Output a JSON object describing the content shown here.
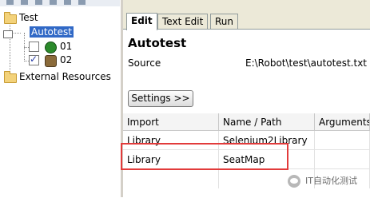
{
  "tree": {
    "root": "Test",
    "suite": "Autotest",
    "children": [
      {
        "label": "01",
        "checked": false
      },
      {
        "label": "02",
        "checked": true
      }
    ],
    "external": "External Resources"
  },
  "tabs": [
    {
      "label": "Edit",
      "active": true
    },
    {
      "label": "Text Edit",
      "active": false
    },
    {
      "label": "Run",
      "active": false
    }
  ],
  "editor": {
    "title": "Autotest",
    "source_label": "Source",
    "source_value": "E:\\Robot\\test\\autotest.txt",
    "settings_button": "Settings >>"
  },
  "table": {
    "columns": [
      "Import",
      "Name / Path",
      "Arguments"
    ],
    "rows": [
      [
        "Library",
        "Selenium2Library",
        ""
      ],
      [
        "Library",
        "SeatMap",
        ""
      ]
    ]
  },
  "watermark": "IT自动化测试",
  "colors": {
    "highlight": "#e23b3b",
    "selected": "#3169c6"
  }
}
